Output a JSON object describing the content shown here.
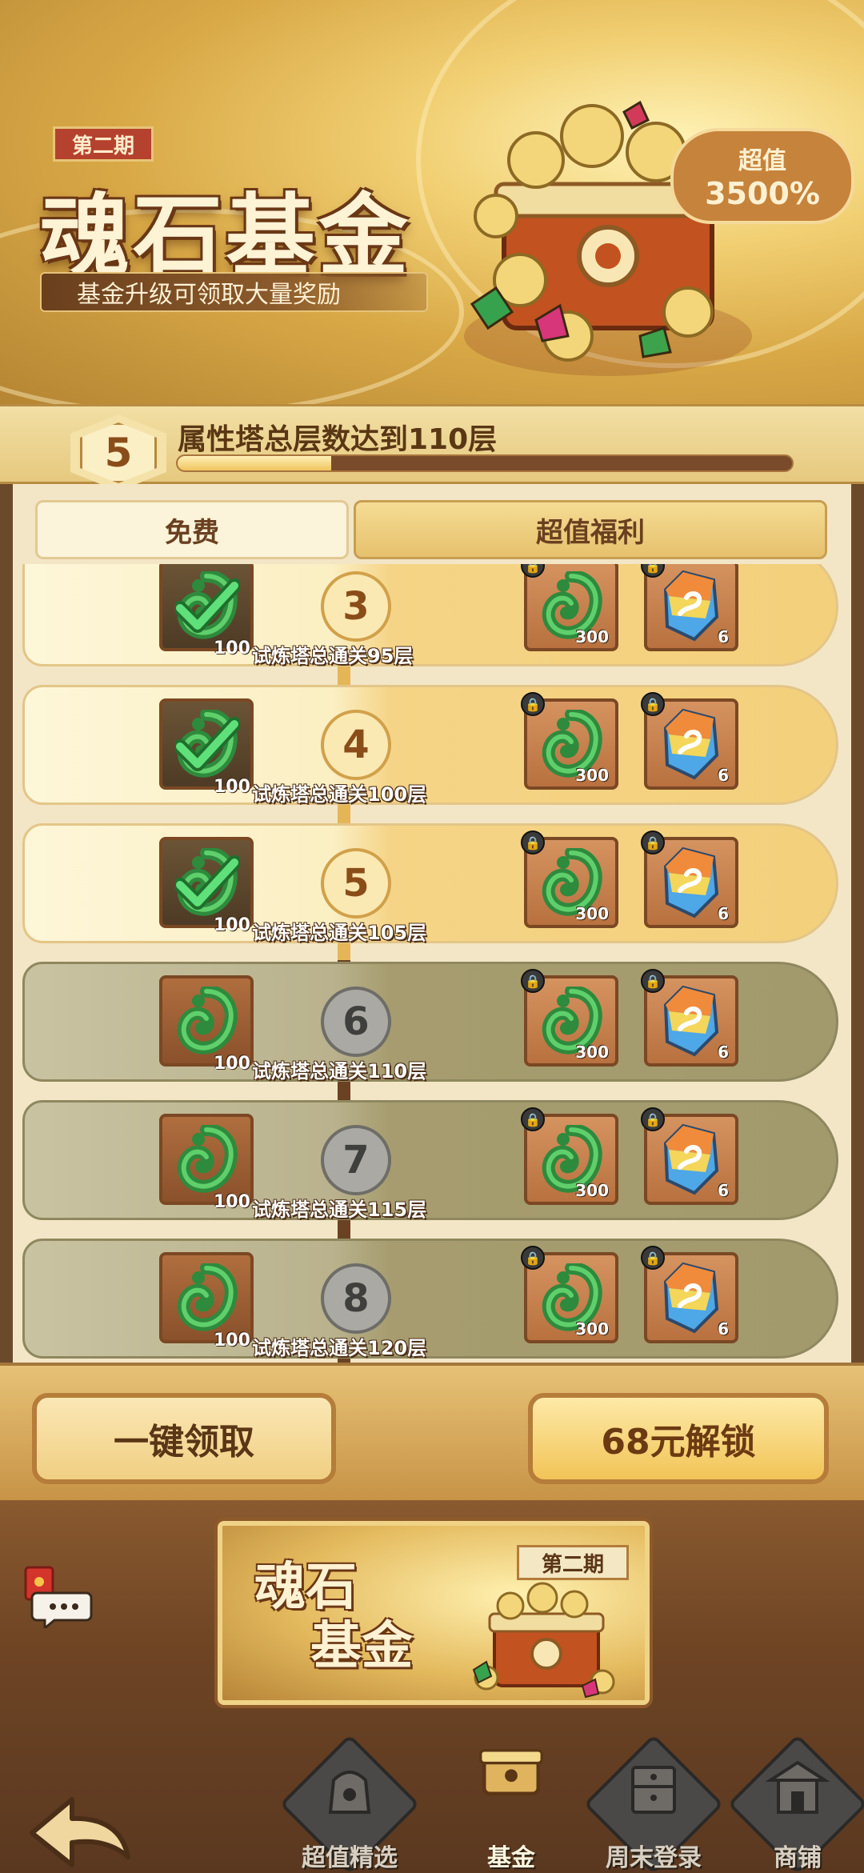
{
  "banner": {
    "period_tag": "第二期",
    "title": "魂石基金",
    "subtitle": "基金升级可领取大量奖励",
    "value_line1": "超值",
    "value_line2": "3500%"
  },
  "progress": {
    "level": "5",
    "text": "属性塔总层数达到110层",
    "fill_fraction": 0.25
  },
  "tabs": {
    "free": "免费",
    "premium": "超值福利"
  },
  "rows": [
    {
      "number": "3",
      "label": "试炼塔总通关95层",
      "free_qty": "100",
      "p1_qty": "300",
      "p2_qty": "6",
      "state": "done"
    },
    {
      "number": "4",
      "label": "试炼塔总通关100层",
      "free_qty": "100",
      "p1_qty": "300",
      "p2_qty": "6",
      "state": "done"
    },
    {
      "number": "5",
      "label": "试炼塔总通关105层",
      "free_qty": "100",
      "p1_qty": "300",
      "p2_qty": "6",
      "state": "done"
    },
    {
      "number": "6",
      "label": "试炼塔总通关110层",
      "free_qty": "100",
      "p1_qty": "300",
      "p2_qty": "6",
      "state": "locked"
    },
    {
      "number": "7",
      "label": "试炼塔总通关115层",
      "free_qty": "100",
      "p1_qty": "300",
      "p2_qty": "6",
      "state": "locked"
    },
    {
      "number": "8",
      "label": "试炼塔总通关120层",
      "free_qty": "100",
      "p1_qty": "300",
      "p2_qty": "6",
      "state": "locked"
    }
  ],
  "actions": {
    "claim_all": "一键领取",
    "unlock": "68元解锁"
  },
  "fund_card": {
    "title_line1": "魂石",
    "title_line2": "基金",
    "tag": "第二期"
  },
  "nav": [
    {
      "label": "超值精选",
      "icon": "gift-bag-icon",
      "active": false
    },
    {
      "label": "基金",
      "icon": "treasure-chest-icon",
      "active": true
    },
    {
      "label": "周末登录",
      "icon": "cabinet-icon",
      "active": false
    },
    {
      "label": "商铺",
      "icon": "shop-pavilion-icon",
      "active": false
    }
  ],
  "colors": {
    "accent_gold": "#f0c45e",
    "done_row": "#fbefc3",
    "locked_row": "#b9b28d",
    "check_green": "#3fc45a"
  }
}
